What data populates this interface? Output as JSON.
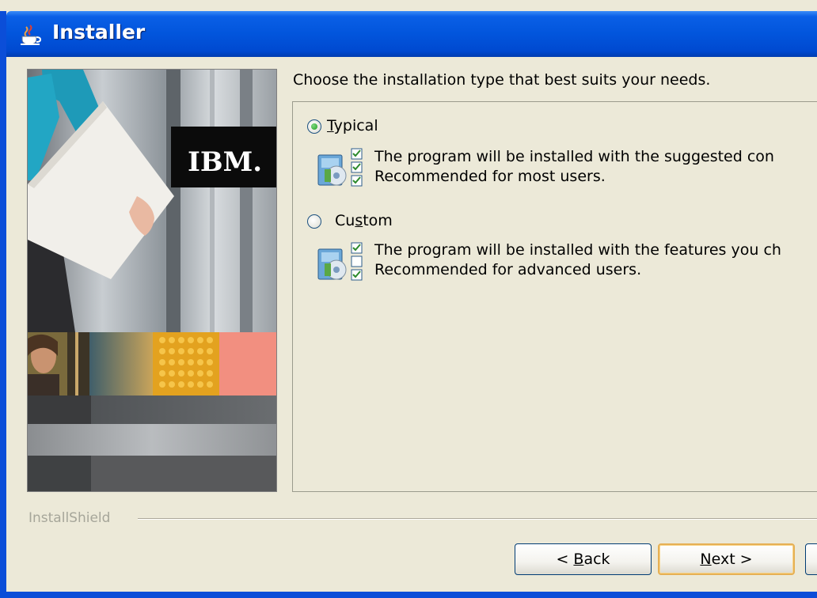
{
  "window": {
    "title": "Installer",
    "icon": "java-cup-icon"
  },
  "banner": {
    "logo_text": "IBM."
  },
  "prompt": "Choose the installation type that best suits your needs.",
  "options": [
    {
      "label_accel": "T",
      "label_rest": "ypical",
      "selected": true,
      "description_line1": "The program will be installed with the suggested con",
      "description_line2": "Recommended for most users.",
      "icon": "installer-components-icon"
    },
    {
      "label_pre": "Cu",
      "label_accel": "s",
      "label_rest": "tom",
      "selected": false,
      "description_line1": "The program will be installed with the features you ch",
      "description_line2": "Recommended for advanced users.",
      "icon": "installer-components-icon"
    }
  ],
  "footer": {
    "brand": "InstallShield"
  },
  "buttons": {
    "back_pre": "< ",
    "back_accel": "B",
    "back_rest": "ack",
    "next_accel": "N",
    "next_rest": "ext >"
  },
  "colors": {
    "titlebar": "#0255dc",
    "dialog_bg": "#ece9d8",
    "default_button_border": "#e6b054"
  }
}
